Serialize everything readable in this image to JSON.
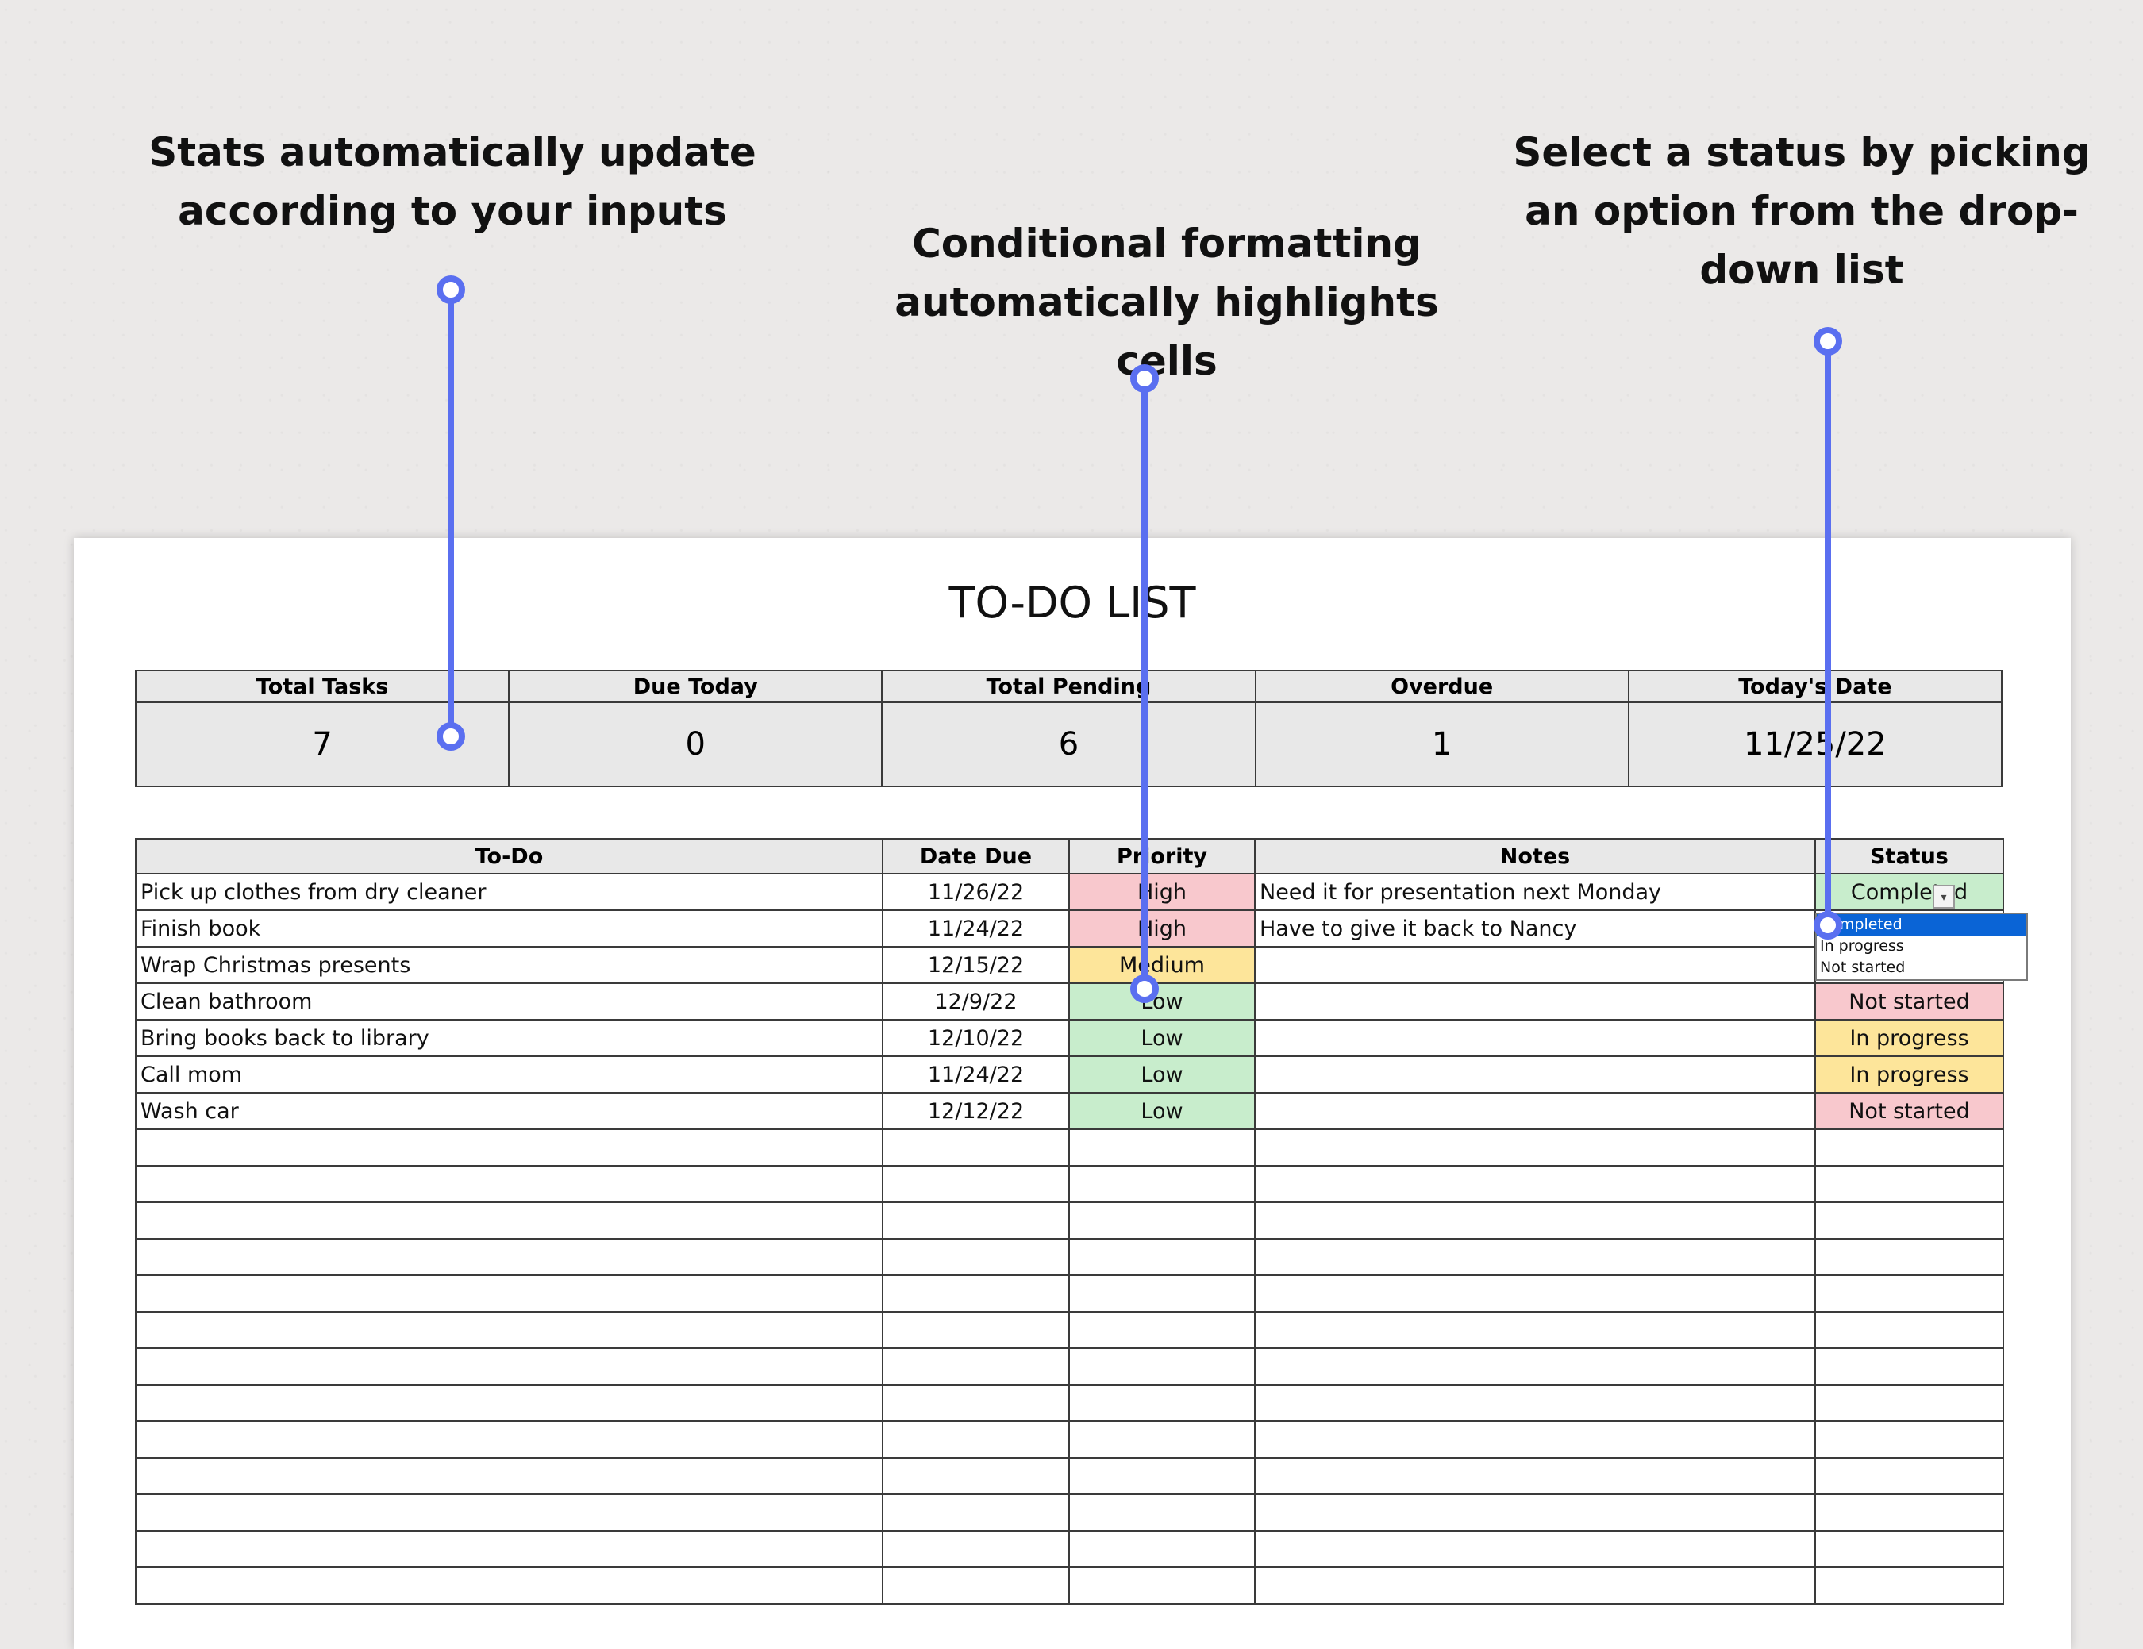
{
  "callouts": {
    "stats": "Stats automatically update according to your inputs",
    "formatting": "Conditional formatting automatically highlights cells",
    "dropdown": "Select a status by picking an option from the drop-down list"
  },
  "sheet": {
    "title": "TO-DO LIST",
    "stats": {
      "headers": [
        "Total Tasks",
        "Due Today",
        "Total Pending",
        "Overdue",
        "Today's Date"
      ],
      "values": [
        "7",
        "0",
        "6",
        "1",
        "11/25/22"
      ]
    },
    "table": {
      "headers": [
        "To-Do",
        "Date Due",
        "Priority",
        "Notes",
        "Status"
      ],
      "rows": [
        {
          "todo": "Pick up clothes from dry cleaner",
          "due": "11/26/22",
          "priority": "High",
          "notes": "Need it for presentation next Monday",
          "status": "Completed"
        },
        {
          "todo": "Finish book",
          "due": "11/24/22",
          "priority": "High",
          "notes": "Have to give it back to Nancy",
          "status": ""
        },
        {
          "todo": "Wrap Christmas presents",
          "due": "12/15/22",
          "priority": "Medium",
          "notes": "",
          "status": ""
        },
        {
          "todo": "Clean bathroom",
          "due": "12/9/22",
          "priority": "Low",
          "notes": "",
          "status": "Not started"
        },
        {
          "todo": "Bring books back to library",
          "due": "12/10/22",
          "priority": "Low",
          "notes": "",
          "status": "In progress"
        },
        {
          "todo": "Call mom",
          "due": "11/24/22",
          "priority": "Low",
          "notes": "",
          "status": "In progress"
        },
        {
          "todo": "Wash car",
          "due": "12/12/22",
          "priority": "Low",
          "notes": "",
          "status": "Not started"
        }
      ],
      "empty_row_count": 13
    },
    "dropdown": {
      "options": [
        "Completed",
        "In progress",
        "Not started"
      ],
      "selected": "Completed",
      "arrow_icon": "chevron-down-icon"
    }
  },
  "colors": {
    "connector": "#5a6ff0",
    "high_bg": "#f8c8cd",
    "medium_bg": "#fde59a",
    "low_bg": "#c8edcc",
    "selected_option": "#0a64d6"
  }
}
